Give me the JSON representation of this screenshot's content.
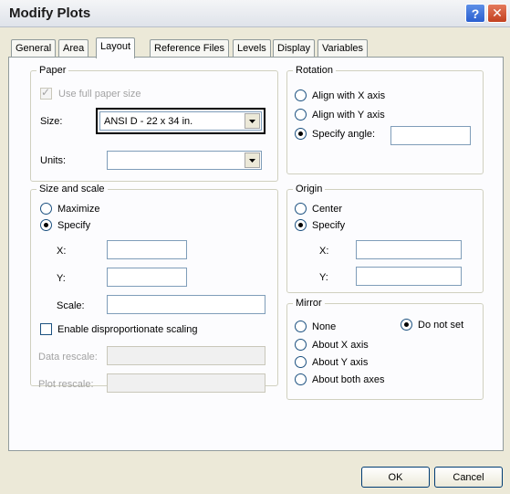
{
  "window": {
    "title": "Modify Plots",
    "help_label": "?",
    "close_label": "✕"
  },
  "tabs": [
    {
      "label": "General"
    },
    {
      "label": "Area"
    },
    {
      "label": "Layout",
      "active": true
    },
    {
      "label": "Reference Files"
    },
    {
      "label": "Levels"
    },
    {
      "label": "Display"
    },
    {
      "label": "Variables"
    }
  ],
  "paper": {
    "group_label": "Paper",
    "use_full_paper_label": "Use full paper size",
    "use_full_paper_checked": true,
    "size_label": "Size:",
    "size_value": "ANSI D - 22 x 34 in.",
    "units_label": "Units:",
    "units_value": ""
  },
  "rotation": {
    "group_label": "Rotation",
    "align_x_label": "Align with  X axis",
    "align_y_label": "Align with Y axis",
    "specify_angle_label": "Specify angle:",
    "selected": "specify_angle",
    "angle_value": ""
  },
  "size_scale": {
    "group_label": "Size and scale",
    "maximize_label": "Maximize",
    "specify_label": "Specify",
    "selected": "specify",
    "x_label": "X:",
    "y_label": "Y:",
    "scale_label": "Scale:",
    "x_value": "",
    "y_value": "",
    "scale_value": "",
    "disproportionate_label": "Enable disproportionate scaling",
    "disproportionate_checked": false,
    "data_rescale_label": "Data rescale:",
    "plot_rescale_label": "Plot rescale:"
  },
  "origin": {
    "group_label": "Origin",
    "center_label": "Center",
    "specify_label": "Specify",
    "selected": "specify",
    "x_label": "X:",
    "y_label": "Y:",
    "x_value": "",
    "y_value": ""
  },
  "mirror": {
    "group_label": "Mirror",
    "none_label": "None",
    "do_not_set_label": "Do not set",
    "about_x_label": "About X axis",
    "about_y_label": "About Y axis",
    "about_both_label": "About both axes",
    "selected": "do_not_set"
  },
  "buttons": {
    "ok_label": "OK",
    "cancel_label": "Cancel"
  }
}
